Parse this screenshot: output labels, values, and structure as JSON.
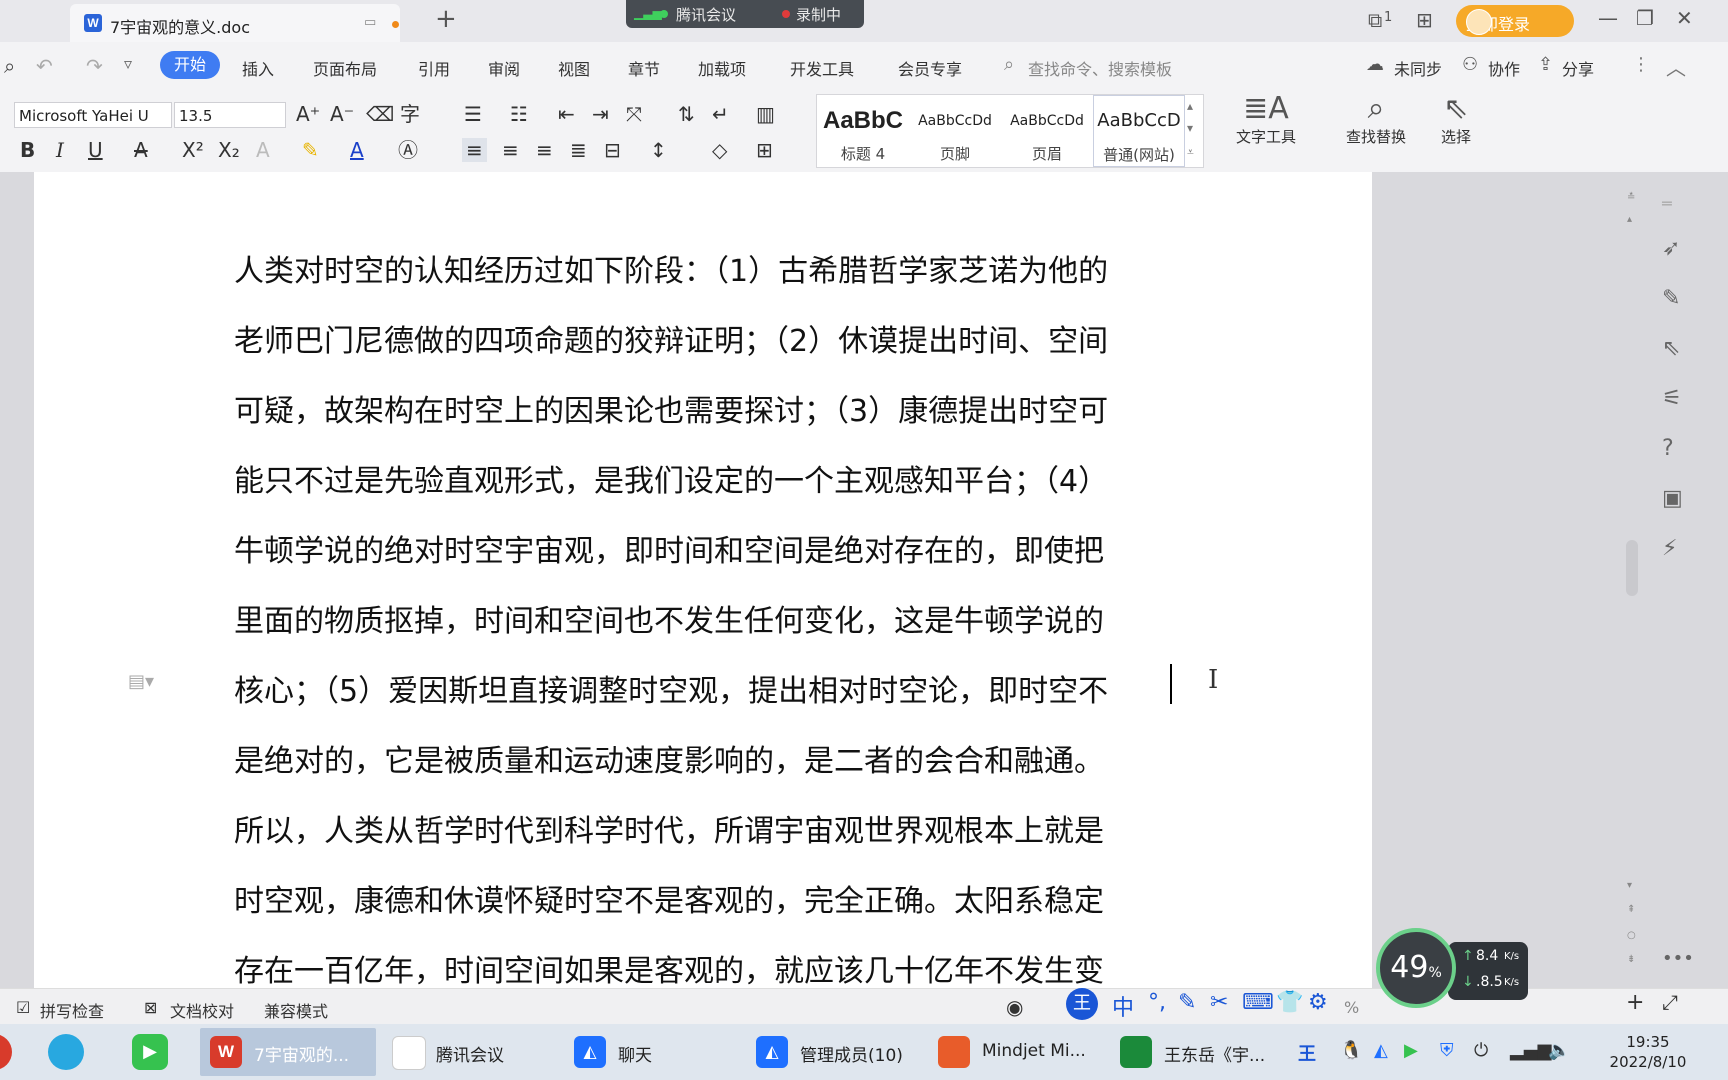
{
  "title_bar": {
    "doc_tab_label": "7宇宙观的意义.doc",
    "new_tab": "+",
    "meeting_label": "腾讯会议",
    "recording_label": "录制中",
    "login_label": "立即登录",
    "page_counter": "1"
  },
  "menu": {
    "items": [
      "开始",
      "插入",
      "页面布局",
      "引用",
      "审阅",
      "视图",
      "章节",
      "加载项",
      "开发工具",
      "会员专享"
    ],
    "search_placeholder": "查找命令、搜索模板",
    "right": [
      "未同步",
      "协作",
      "分享"
    ]
  },
  "ribbon": {
    "font_name": "Microsoft YaHei U",
    "font_size": "13.5",
    "styles": [
      {
        "preview": "AaBbC",
        "label": "标题 4"
      },
      {
        "preview": "AaBbCcDd",
        "label": "页脚"
      },
      {
        "preview": "AaBbCcDd",
        "label": "页眉"
      },
      {
        "preview": "AaBbCcD",
        "label": "普通(网站)"
      }
    ],
    "text_tools_label": "文字工具",
    "find_replace_label": "查找替换",
    "select_label": "选择"
  },
  "document": {
    "lines": [
      "人类对时空的认知经历过如下阶段：（1）古希腊哲学家芝诺为他的",
      "老师巴门尼德做的四项命题的狡辩证明；（2）休谟提出时间、空间",
      "可疑，故架构在时空上的因果论也需要探讨；（3）康德提出时空可",
      "能只不过是先验直观形式，是我们设定的一个主观感知平台；（4）",
      "牛顿学说的绝对时空宇宙观，即时间和空间是绝对存在的，即使把",
      "里面的物质抠掉，时间和空间也不发生任何变化，这是牛顿学说的",
      "核心；（5）爱因斯坦直接调整时空观，提出相对时空论，即时空不",
      "是绝对的，它是被质量和运动速度影响的，是二者的会合和融通。",
      "所以，人类从哲学时代到科学时代，所谓宇宙观世界观根本上就是",
      "时空观，康德和休谟怀疑时空不是客观的，完全正确。太阳系稳定",
      "存在一百亿年，时间空间如果是客观的，就应该几十亿年不发生变"
    ]
  },
  "status_bar": {
    "spell_check": "拼写检查",
    "doc_proof": "文档校对",
    "compat_mode": "兼容模式",
    "ime_mode": "中",
    "zoom_suffix": "%"
  },
  "speed_widget": {
    "percent": "49",
    "percent_sign": "%",
    "up": "8.4",
    "down": ".8.5",
    "unit": "K/s"
  },
  "taskbar": {
    "items": [
      {
        "label": "7宇宙观的...",
        "active": true,
        "color": "#d83b2b"
      },
      {
        "label": "腾讯会议",
        "active": false,
        "color": "#ffffff"
      },
      {
        "label": "聊天",
        "active": false,
        "color": "#1e6fff"
      },
      {
        "label": "管理成员(10)",
        "active": false,
        "color": "#1e6fff"
      },
      {
        "label": "Mindjet Mi...",
        "active": false,
        "color": "#e85c2a"
      },
      {
        "label": "王东岳《宇...",
        "active": false,
        "color": "#1b8a3a"
      }
    ],
    "time": "19:35",
    "date": "2022/8/10"
  },
  "colors": {
    "accent": "#3f7cf2",
    "login": "#f6a928",
    "page": "#ffffff",
    "canvas": "#d9d9dd"
  }
}
